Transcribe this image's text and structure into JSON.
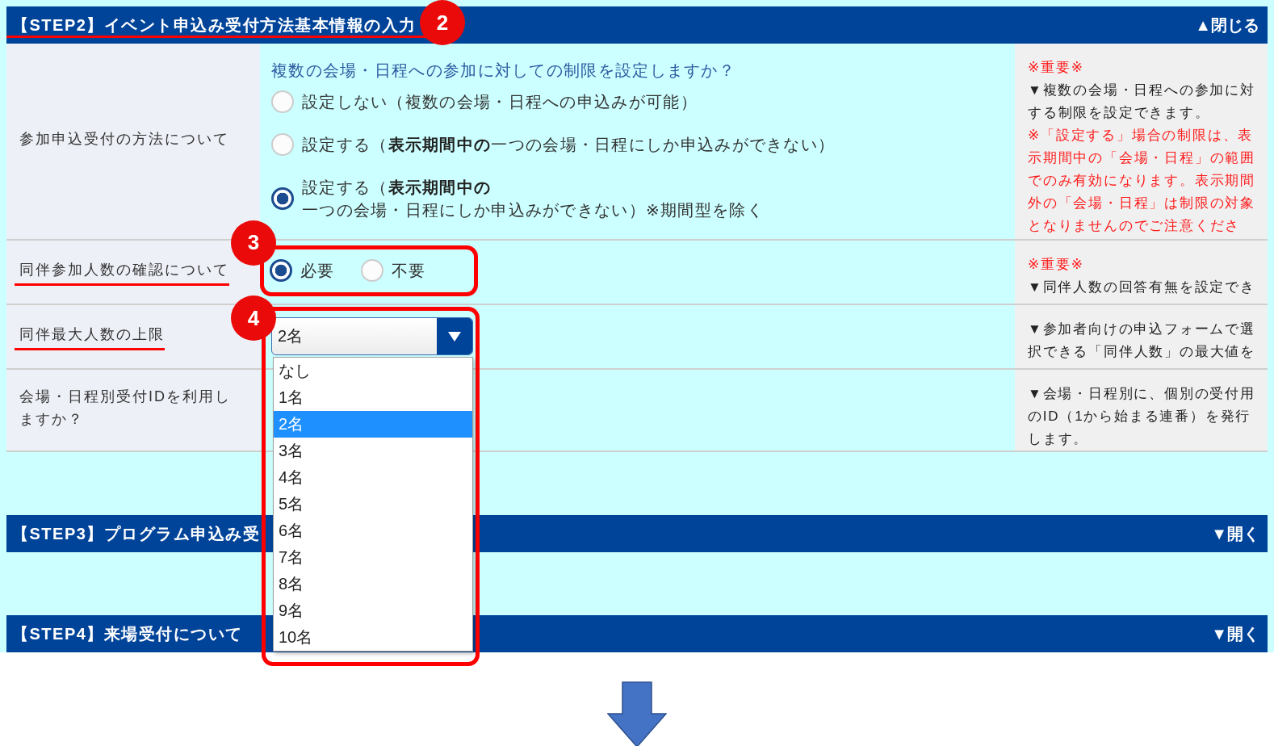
{
  "sections": [
    {
      "title": "【STEP2】イベント申込み受付方法基本情報の入力",
      "toggle": "▲閉じる",
      "underlined": true,
      "badge": "2",
      "rows": [
        {
          "label": "参加申込受付の方法について",
          "underlined": false,
          "highlighted": false,
          "control": {
            "kind": "radio_list",
            "question": "複数の会場・日程への参加に対しての制限を設定しますか？",
            "options": [
              {
                "lines": [
                  "設定しない（複数の会場・日程への申込みが可能）"
                ],
                "selected": false
              },
              {
                "lines": [
                  "設定する（**表示期間中の**一つの会場・日程にしか申込みができない）"
                ],
                "selected": false
              },
              {
                "lines": [
                  "設定する（**表示期間中の**",
                  "一つの会場・日程にしか申込みができない）※期間型を除く"
                ],
                "selected": true
              }
            ]
          },
          "note": {
            "important": "※重要※",
            "text": "▼複数の会場・日程への参加に対する制限を設定できます。",
            "warning": "※「設定する」場合の制限は、表示期間中の「会場・日程」の範囲でのみ有効になります。表示期間外の「会場・日程」は制限の対象となりませんのでご注意くださ"
          }
        },
        {
          "label": "同伴参加人数の確認について",
          "underlined": true,
          "highlighted": true,
          "badge": "3",
          "control": {
            "kind": "radio_inline",
            "options": [
              {
                "lines": [
                  "必要"
                ],
                "selected": true
              },
              {
                "lines": [
                  "不要"
                ],
                "selected": false
              }
            ]
          },
          "note": {
            "important": "※重要※",
            "text": "▼同伴人数の回答有無を設定でき"
          }
        },
        {
          "label": "同伴最大人数の上限",
          "underlined": true,
          "highlighted": true,
          "badge": "4",
          "control": {
            "kind": "select",
            "value": "2名",
            "expanded": true,
            "options": [
              {
                "label": "なし",
                "selected": false
              },
              {
                "label": "1名",
                "selected": false
              },
              {
                "label": "2名",
                "selected": true
              },
              {
                "label": "3名",
                "selected": false
              },
              {
                "label": "4名",
                "selected": false
              },
              {
                "label": "5名",
                "selected": false
              },
              {
                "label": "6名",
                "selected": false
              },
              {
                "label": "7名",
                "selected": false
              },
              {
                "label": "8名",
                "selected": false
              },
              {
                "label": "9名",
                "selected": false
              },
              {
                "label": "10名",
                "selected": false
              }
            ]
          },
          "note": {
            "text": "▼参加者向けの申込フォームで選択できる「同伴人数」の最大値を"
          }
        },
        {
          "label": "会場・日程別受付IDを利用しますか？",
          "underlined": false,
          "note": {
            "text": "▼会場・日程別に、個別の受付用のID（1から始まる連番）を発行します。"
          }
        }
      ]
    },
    {
      "title": "【STEP3】プログラム申込み受",
      "toggle": "▼開く",
      "underlined": false
    },
    {
      "title": "【STEP4】来場受付について",
      "toggle": "▼開く",
      "underlined": false
    }
  ]
}
